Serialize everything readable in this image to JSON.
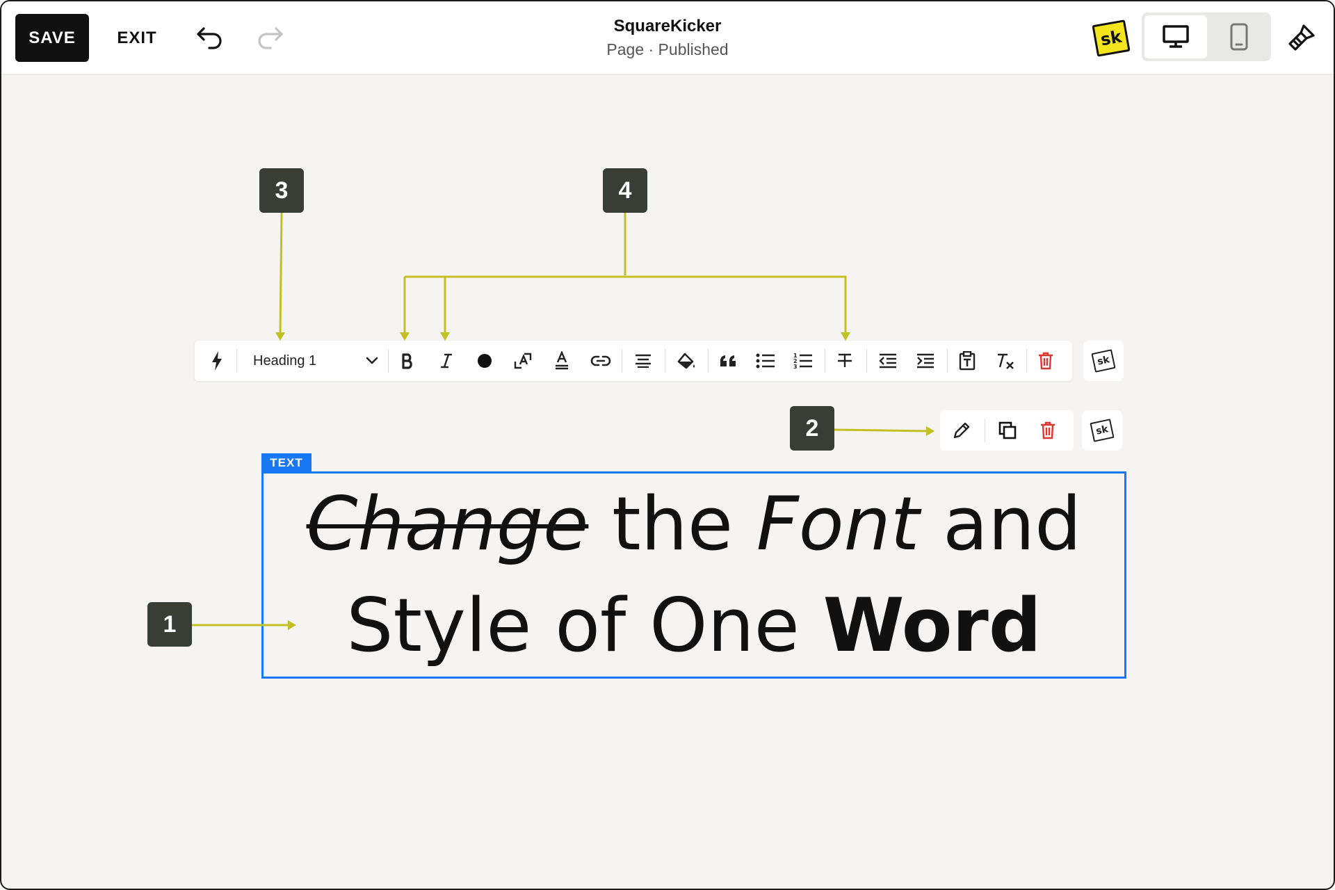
{
  "topbar": {
    "save_label": "SAVE",
    "exit_label": "EXIT",
    "site_name": "SquareKicker",
    "page_status": "Page · Published",
    "logo_text": "sk"
  },
  "icons": {
    "undo": "undo-icon",
    "redo": "redo-icon",
    "desktop": "desktop-icon",
    "mobile": "mobile-icon",
    "brush": "paintbrush-icon"
  },
  "toolbar": {
    "heading_value": "Heading 1",
    "items": [
      "lightning-icon",
      "bold-icon",
      "italic-icon",
      "color-dot-icon",
      "font-size-icon",
      "text-color-icon",
      "link-icon",
      "align-icon",
      "highlight-icon",
      "quote-icon",
      "bullet-list-icon",
      "numbered-list-icon",
      "strikethrough-icon",
      "outdent-icon",
      "indent-icon",
      "clipboard-text-icon",
      "clear-format-icon",
      "trash-icon"
    ],
    "sk_badge": "sk"
  },
  "block_toolbar": {
    "items": [
      "pencil-icon",
      "duplicate-icon",
      "trash-icon"
    ],
    "sk_badge": "sk"
  },
  "text_block": {
    "tag": "TEXT",
    "line1_strike": "Change",
    "line1_mid": " the ",
    "line1_italic": "Font",
    "line1_end": " and",
    "line2_start": "Style of One ",
    "line2_bold": "Word"
  },
  "callouts": [
    "1",
    "2",
    "3",
    "4"
  ],
  "colors": {
    "accent_blue": "#1877f2",
    "annotation_line": "#c2c022",
    "callout_bg": "#383e35",
    "delete_red": "#e0342f",
    "logo_yellow": "#f5e51c"
  }
}
